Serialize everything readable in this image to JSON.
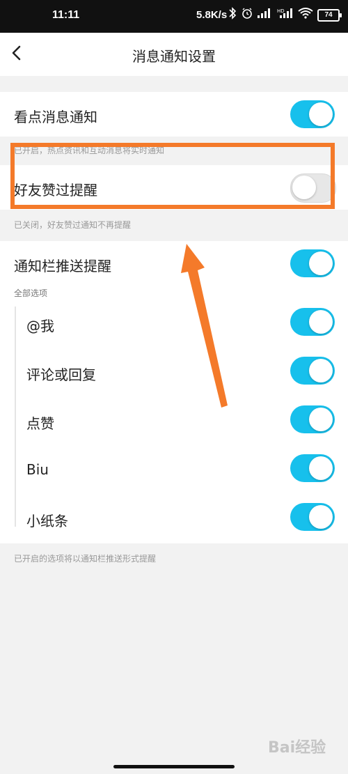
{
  "status_bar": {
    "time": "11:11",
    "network_speed": "5.8K/s",
    "battery": "74"
  },
  "header": {
    "title": "消息通知设置"
  },
  "settings": {
    "view_news": {
      "label": "看点消息通知",
      "enabled": true,
      "hint": "已开启，热点资讯和互动消息将实时通知"
    },
    "friend_like": {
      "label": "好友赞过提醒",
      "enabled": false,
      "hint": "已关闭，好友赞过通知不再提醒"
    },
    "push": {
      "label": "通知栏推送提醒",
      "enabled": true,
      "options_label": "全部选项",
      "options": [
        {
          "label": "@我",
          "enabled": true
        },
        {
          "label": "评论或回复",
          "enabled": true
        },
        {
          "label": "点赞",
          "enabled": true
        },
        {
          "label": "Biu",
          "enabled": true
        },
        {
          "label": "小纸条",
          "enabled": true
        }
      ],
      "footer_hint": "已开启的选项将以通知栏推送形式提醒"
    }
  },
  "watermark": "Bai经验",
  "colors": {
    "toggle_on": "#17c0ec",
    "annotation": "#f47a2a"
  }
}
